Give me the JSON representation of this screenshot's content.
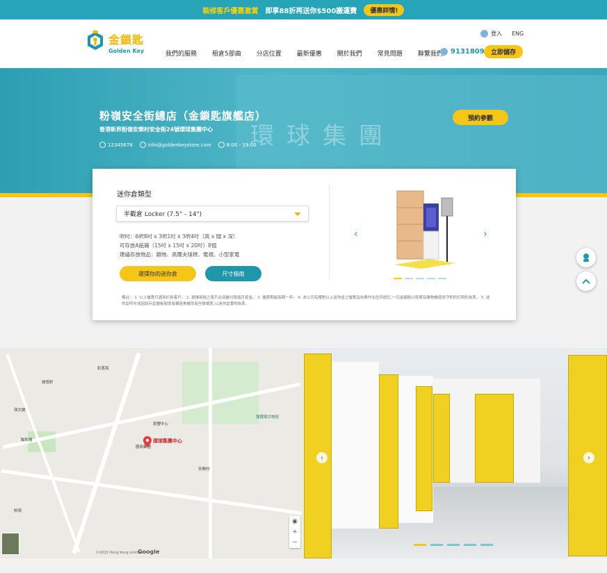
{
  "promo": {
    "text_prefix": "裝修客戶優惠激賞",
    "text_main": "即享88折再送你$500搬運費",
    "button": "優惠詳情!"
  },
  "brand": {
    "zh": "金鎖匙",
    "en": "Golden Key"
  },
  "nav": [
    "我們的服務",
    "租倉5部曲",
    "分店位置",
    "最新優惠",
    "關於我們",
    "常見問題",
    "聯繫我們"
  ],
  "header": {
    "login": "登入",
    "lang": "ENG",
    "phone": "91318093",
    "store_now": "立即儲存"
  },
  "hero": {
    "sign": "環球集團",
    "title": "粉嶺安全街總店（金鎖匙旗艦店）",
    "address": "香港新界粉嶺安樂村安全街24號環球集團中心",
    "phone": "12345678",
    "email": "info@goldenkeystore.com",
    "hours": "8:00 - 19:00",
    "visit_button": "預約參觀"
  },
  "card": {
    "title": "迷你倉類型",
    "selected_type": "半截倉 Locker (7.5\" - 14\")",
    "spec1": "呎吋：6呎8吋 x 3呎1吋 x 3呎4吋（高 x 闊 x 深）",
    "spec2": "可存放A紙箱（15吋 x 15吋 x 20吋）8個",
    "spec3": "建議存放物品：雜物、高爾夫球桿、電視、小型家電",
    "choose_button": "選擇你的迷你倉",
    "size_button": "尺寸指南",
    "note": "備註： 1. 以上優惠只適用於新客戶。 2. 選擇用租之客戶必須繳付兩個月按金。 3. 優惠期最長期一年。 4. 本公司有權對以上迷你倉之優惠及收費作出任何修訂,一切金額將以發票及雜物機使用守則所訂明的為準。 5. 迷你倉呎吋或因該存倉圖板製度或構造美麗而有些微偏差,以迷你倉實物為準。",
    "carousel_index": 1,
    "carousel_count": 5
  },
  "map": {
    "pin_label": "環球集團中心",
    "labels": [
      "安樂村",
      "彩蒸苑",
      "綠悠軒",
      "嶺文閣",
      "國商集團",
      "恩豐中心",
      "聯和墟",
      "粉嶺",
      "龍躍頭文物徑"
    ],
    "copyright": "©2023 Hong Kong Limited",
    "attribution": "Google"
  },
  "photo": {
    "carousel_index": 1,
    "carousel_count": 5
  },
  "icons": {
    "chat": "chat-agent-icon",
    "top": "chevron-up-icon"
  },
  "colors": {
    "teal": "#1f97ab",
    "yellow": "#f5c518"
  }
}
